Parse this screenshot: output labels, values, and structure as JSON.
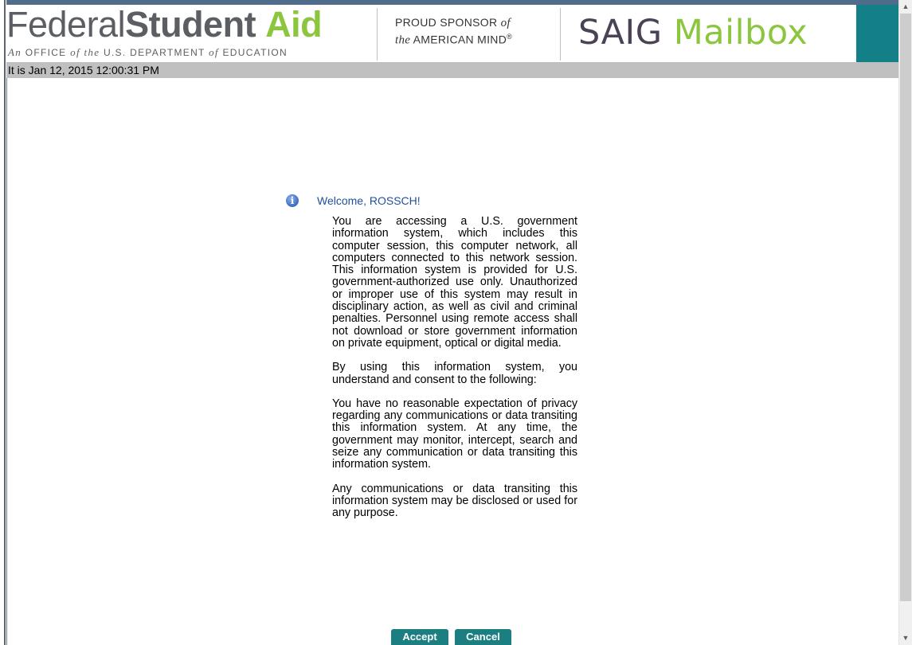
{
  "header": {
    "logo": {
      "federal": "Federal",
      "student": "Student",
      "aid": "Aid",
      "tagline_prefix": "An",
      "tagline_office": "OFFICE",
      "tagline_of1": "of",
      "tagline_the": "the",
      "tagline_dept": "U.S. DEPARTMENT",
      "tagline_of2": "of",
      "tagline_edu": "EDUCATION"
    },
    "sponsor_line1_a": "PROUD SPONSOR",
    "sponsor_line1_b": "of",
    "sponsor_line2_a": "the",
    "sponsor_line2_b": "AMERICAN MIND",
    "sponsor_reg": "®",
    "title_saig": "SAIG",
    "title_mailbox": "Mailbox",
    "colors": {
      "logo_gray": "#5b5e63",
      "logo_green": "#8cc63f",
      "title_purple": "#4b4255",
      "teal": "#138088"
    }
  },
  "date_bar": {
    "text": "It is Jan 12, 2015 12:00:31 PM"
  },
  "welcome": {
    "icon": "info-icon",
    "icon_glyph": "i",
    "text": "Welcome, ROSSCH!"
  },
  "notice": {
    "paragraphs": [
      "You are accessing a U.S. government information system, which includes this computer session, this computer network, all computers connected to this network session. This information system is provided for U.S. government-authorized use only. Unauthorized or improper use of this system may result in disciplinary action, as well as civil and criminal penalties. Personnel using remote access shall not download or store government information on private equipment, optical or digital media.",
      "By using this information system, you understand and consent to the following:",
      "You have no reasonable expectation of privacy regarding any communications or data transiting this information system. At any time, the government may monitor, intercept, search and seize any communication or data transiting this information system.",
      "Any communications or data transiting this information system may be disclosed or used for any purpose."
    ]
  },
  "buttons": {
    "accept": "Accept",
    "cancel": "Cancel",
    "color": "#1b7f82"
  },
  "scrollbar": {
    "up_icon": "scroll-up-arrow-icon",
    "down_icon": "scroll-down-arrow-icon",
    "up_glyph": "▲",
    "down_glyph": "▼"
  }
}
